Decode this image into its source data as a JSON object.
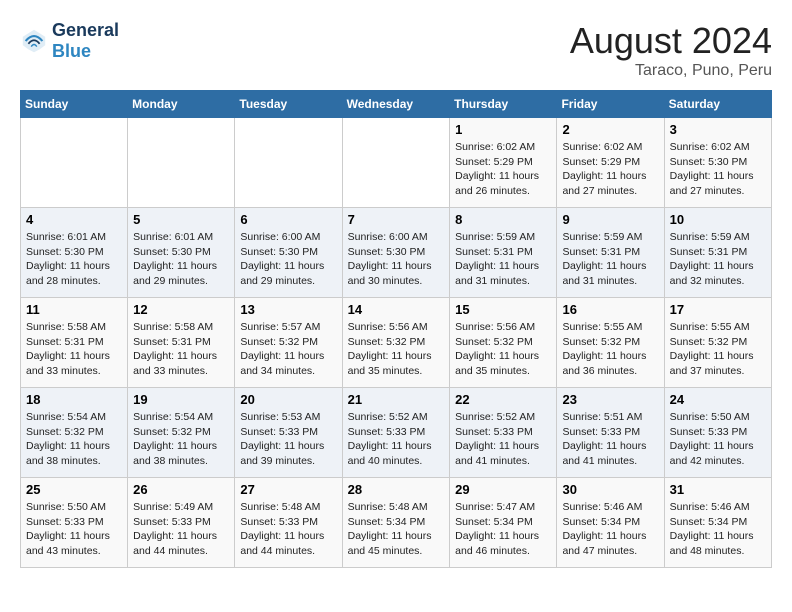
{
  "header": {
    "logo_line1": "General",
    "logo_line2": "Blue",
    "month_year": "August 2024",
    "location": "Taraco, Puno, Peru"
  },
  "days_of_week": [
    "Sunday",
    "Monday",
    "Tuesday",
    "Wednesday",
    "Thursday",
    "Friday",
    "Saturday"
  ],
  "weeks": [
    [
      {
        "day": "",
        "info": ""
      },
      {
        "day": "",
        "info": ""
      },
      {
        "day": "",
        "info": ""
      },
      {
        "day": "",
        "info": ""
      },
      {
        "day": "1",
        "info": "Sunrise: 6:02 AM\nSunset: 5:29 PM\nDaylight: 11 hours and 26 minutes."
      },
      {
        "day": "2",
        "info": "Sunrise: 6:02 AM\nSunset: 5:29 PM\nDaylight: 11 hours and 27 minutes."
      },
      {
        "day": "3",
        "info": "Sunrise: 6:02 AM\nSunset: 5:30 PM\nDaylight: 11 hours and 27 minutes."
      }
    ],
    [
      {
        "day": "4",
        "info": "Sunrise: 6:01 AM\nSunset: 5:30 PM\nDaylight: 11 hours and 28 minutes."
      },
      {
        "day": "5",
        "info": "Sunrise: 6:01 AM\nSunset: 5:30 PM\nDaylight: 11 hours and 29 minutes."
      },
      {
        "day": "6",
        "info": "Sunrise: 6:00 AM\nSunset: 5:30 PM\nDaylight: 11 hours and 29 minutes."
      },
      {
        "day": "7",
        "info": "Sunrise: 6:00 AM\nSunset: 5:30 PM\nDaylight: 11 hours and 30 minutes."
      },
      {
        "day": "8",
        "info": "Sunrise: 5:59 AM\nSunset: 5:31 PM\nDaylight: 11 hours and 31 minutes."
      },
      {
        "day": "9",
        "info": "Sunrise: 5:59 AM\nSunset: 5:31 PM\nDaylight: 11 hours and 31 minutes."
      },
      {
        "day": "10",
        "info": "Sunrise: 5:59 AM\nSunset: 5:31 PM\nDaylight: 11 hours and 32 minutes."
      }
    ],
    [
      {
        "day": "11",
        "info": "Sunrise: 5:58 AM\nSunset: 5:31 PM\nDaylight: 11 hours and 33 minutes."
      },
      {
        "day": "12",
        "info": "Sunrise: 5:58 AM\nSunset: 5:31 PM\nDaylight: 11 hours and 33 minutes."
      },
      {
        "day": "13",
        "info": "Sunrise: 5:57 AM\nSunset: 5:32 PM\nDaylight: 11 hours and 34 minutes."
      },
      {
        "day": "14",
        "info": "Sunrise: 5:56 AM\nSunset: 5:32 PM\nDaylight: 11 hours and 35 minutes."
      },
      {
        "day": "15",
        "info": "Sunrise: 5:56 AM\nSunset: 5:32 PM\nDaylight: 11 hours and 35 minutes."
      },
      {
        "day": "16",
        "info": "Sunrise: 5:55 AM\nSunset: 5:32 PM\nDaylight: 11 hours and 36 minutes."
      },
      {
        "day": "17",
        "info": "Sunrise: 5:55 AM\nSunset: 5:32 PM\nDaylight: 11 hours and 37 minutes."
      }
    ],
    [
      {
        "day": "18",
        "info": "Sunrise: 5:54 AM\nSunset: 5:32 PM\nDaylight: 11 hours and 38 minutes."
      },
      {
        "day": "19",
        "info": "Sunrise: 5:54 AM\nSunset: 5:32 PM\nDaylight: 11 hours and 38 minutes."
      },
      {
        "day": "20",
        "info": "Sunrise: 5:53 AM\nSunset: 5:33 PM\nDaylight: 11 hours and 39 minutes."
      },
      {
        "day": "21",
        "info": "Sunrise: 5:52 AM\nSunset: 5:33 PM\nDaylight: 11 hours and 40 minutes."
      },
      {
        "day": "22",
        "info": "Sunrise: 5:52 AM\nSunset: 5:33 PM\nDaylight: 11 hours and 41 minutes."
      },
      {
        "day": "23",
        "info": "Sunrise: 5:51 AM\nSunset: 5:33 PM\nDaylight: 11 hours and 41 minutes."
      },
      {
        "day": "24",
        "info": "Sunrise: 5:50 AM\nSunset: 5:33 PM\nDaylight: 11 hours and 42 minutes."
      }
    ],
    [
      {
        "day": "25",
        "info": "Sunrise: 5:50 AM\nSunset: 5:33 PM\nDaylight: 11 hours and 43 minutes."
      },
      {
        "day": "26",
        "info": "Sunrise: 5:49 AM\nSunset: 5:33 PM\nDaylight: 11 hours and 44 minutes."
      },
      {
        "day": "27",
        "info": "Sunrise: 5:48 AM\nSunset: 5:33 PM\nDaylight: 11 hours and 44 minutes."
      },
      {
        "day": "28",
        "info": "Sunrise: 5:48 AM\nSunset: 5:34 PM\nDaylight: 11 hours and 45 minutes."
      },
      {
        "day": "29",
        "info": "Sunrise: 5:47 AM\nSunset: 5:34 PM\nDaylight: 11 hours and 46 minutes."
      },
      {
        "day": "30",
        "info": "Sunrise: 5:46 AM\nSunset: 5:34 PM\nDaylight: 11 hours and 47 minutes."
      },
      {
        "day": "31",
        "info": "Sunrise: 5:46 AM\nSunset: 5:34 PM\nDaylight: 11 hours and 48 minutes."
      }
    ]
  ]
}
